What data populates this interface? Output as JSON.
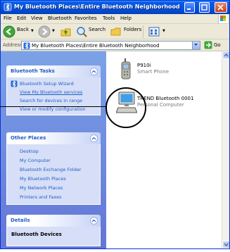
{
  "window": {
    "title": "My Bluetooth Places\\Entire Bluetooth Neighborhood"
  },
  "menu": [
    "File",
    "Edit",
    "View",
    "Bluetooth",
    "Favorites",
    "Tools",
    "Help"
  ],
  "toolbar": {
    "back_label": "Back",
    "search_label": "Search",
    "folders_label": "Folders"
  },
  "address": {
    "label": "Address",
    "value": "My Bluetooth Places\\Entire Bluetooth Neighborhood",
    "go_label": "Go"
  },
  "bluetooth_tasks": {
    "title": "Bluetooth Tasks",
    "items": [
      "Bluetooth Setup Wizard",
      "View My Bluetooth services",
      "Search for devices in range",
      "View or modify configuration"
    ]
  },
  "other_places": {
    "title": "Other Places",
    "items": [
      "Desktop",
      "My Computer",
      "Bluetooth Exchange Folder",
      "My Bluetooth Places",
      "My Network Places",
      "Printers and Faxes"
    ]
  },
  "details": {
    "title": "Details",
    "value": "Bluetooth Devices"
  },
  "devices": [
    {
      "name": "P910i",
      "type": "Smart Phone",
      "icon": "phone-icon"
    },
    {
      "name": "TREND Bluetooth 0001",
      "type": "Personal Computer",
      "icon": "computer-icon"
    }
  ],
  "colors": {
    "titlebar": "#0054e3",
    "task_link": "#215dc6",
    "left_pane": "#7ba2e7"
  }
}
